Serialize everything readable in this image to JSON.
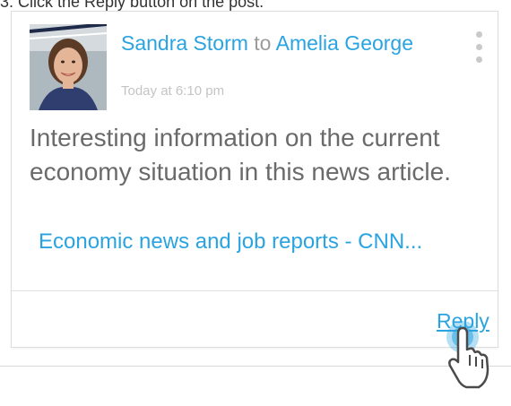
{
  "caption": "3. Click the Reply button on the post.",
  "post": {
    "author": "Sandra Storm",
    "to_word": "to",
    "recipient": "Amelia George",
    "timestamp": "Today at 6:10 pm",
    "message": "Interesting information on the current economy situation in this news article.",
    "link_text": "Economic news and job reports - CNN...",
    "reply_label": "Reply"
  },
  "icons": {
    "menu": "more-vertical-icon",
    "cursor": "hand-pointer-icon"
  },
  "colors": {
    "accent": "#2aa4e0",
    "muted": "#9b9b9b",
    "body_text": "#6a6a6a",
    "timestamp": "#c4c4c4",
    "menu_dots": "#c9c9c9"
  }
}
